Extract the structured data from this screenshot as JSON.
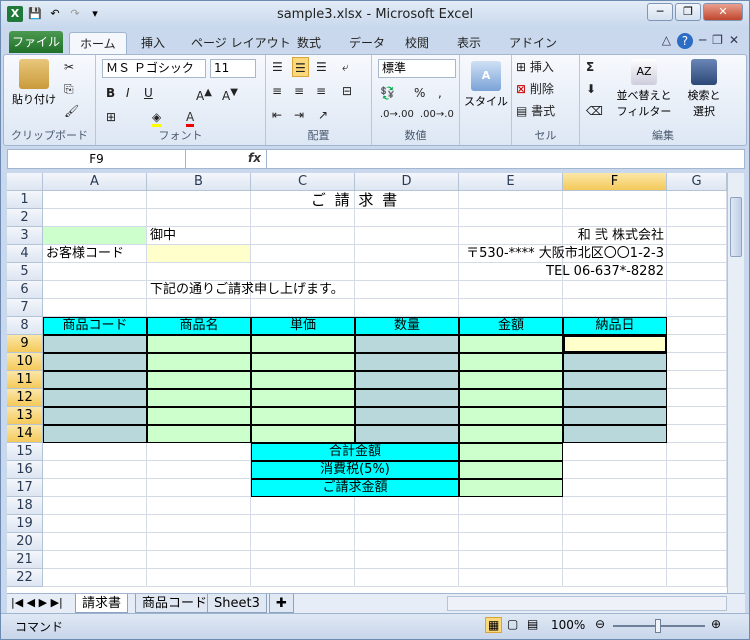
{
  "window": {
    "title": "sample3.xlsx - Microsoft Excel",
    "minimize": "─",
    "restore": "❐",
    "close": "✕"
  },
  "qat": {
    "save": "💾",
    "undo": "↶",
    "redo": "↷",
    "customize": "▾"
  },
  "ribbon_tabs": {
    "file": "ファイル",
    "home": "ホーム",
    "insert": "挿入",
    "page_layout": "ページ レイアウト",
    "formulas": "数式",
    "data": "データ",
    "review": "校閲",
    "view": "表示",
    "addins": "アドイン"
  },
  "ribbon": {
    "clipboard": {
      "paste": "貼り付け",
      "label": "クリップボード"
    },
    "font": {
      "name": "ＭＳ Ｐゴシック",
      "size": "11",
      "bold": "B",
      "italic": "I",
      "underline": "U",
      "label": "フォント"
    },
    "alignment": {
      "label": "配置"
    },
    "number": {
      "format": "標準",
      "label": "数値",
      "percent": "%",
      "comma": ","
    },
    "styles": {
      "style": "スタイル"
    },
    "cells": {
      "insert": "挿入",
      "delete": "削除",
      "format": "書式",
      "label": "セル"
    },
    "editing": {
      "sum": "Σ",
      "sort": "並べ替えと\nフィルター",
      "find": "検索と\n選択",
      "label": "編集",
      "sort1": "並べ替えと",
      "sort2": "フィルター",
      "find1": "検索と",
      "find2": "選択"
    }
  },
  "formula_bar": {
    "name_box": "F9",
    "fx": "fx",
    "value": ""
  },
  "columns": [
    "A",
    "B",
    "C",
    "D",
    "E",
    "F",
    "G"
  ],
  "rows": [
    "1",
    "2",
    "3",
    "4",
    "5",
    "6",
    "7",
    "8",
    "9",
    "10",
    "11",
    "12",
    "13",
    "14",
    "15",
    "16",
    "17",
    "18",
    "19",
    "20",
    "21",
    "22"
  ],
  "cells": {
    "title": "ご 請 求 書",
    "b3": "御中",
    "a4": "お客様コード",
    "company": "和 弐 株式会社",
    "address": "〒530-**** 大阪市北区〇〇1-2-3",
    "tel": "TEL 06-637*-8282",
    "b6": "下記の通りご請求申し上げます。",
    "headers": [
      "商品コード",
      "商品名",
      "単価",
      "数量",
      "金額",
      "納品日"
    ],
    "total": "合計金額",
    "tax": "消費税(5%)",
    "grand": "ご請求金額"
  },
  "sheets": [
    "請求書",
    "商品コード",
    "Sheet3"
  ],
  "status": {
    "mode": "コマンド",
    "zoom": "100%"
  },
  "colors": {
    "cyan": "#00ffff",
    "light_green": "#ccffcc",
    "blue_gray": "#b8d8dc",
    "light_yellow": "#ffffcc",
    "selection": "#f4c95a"
  }
}
